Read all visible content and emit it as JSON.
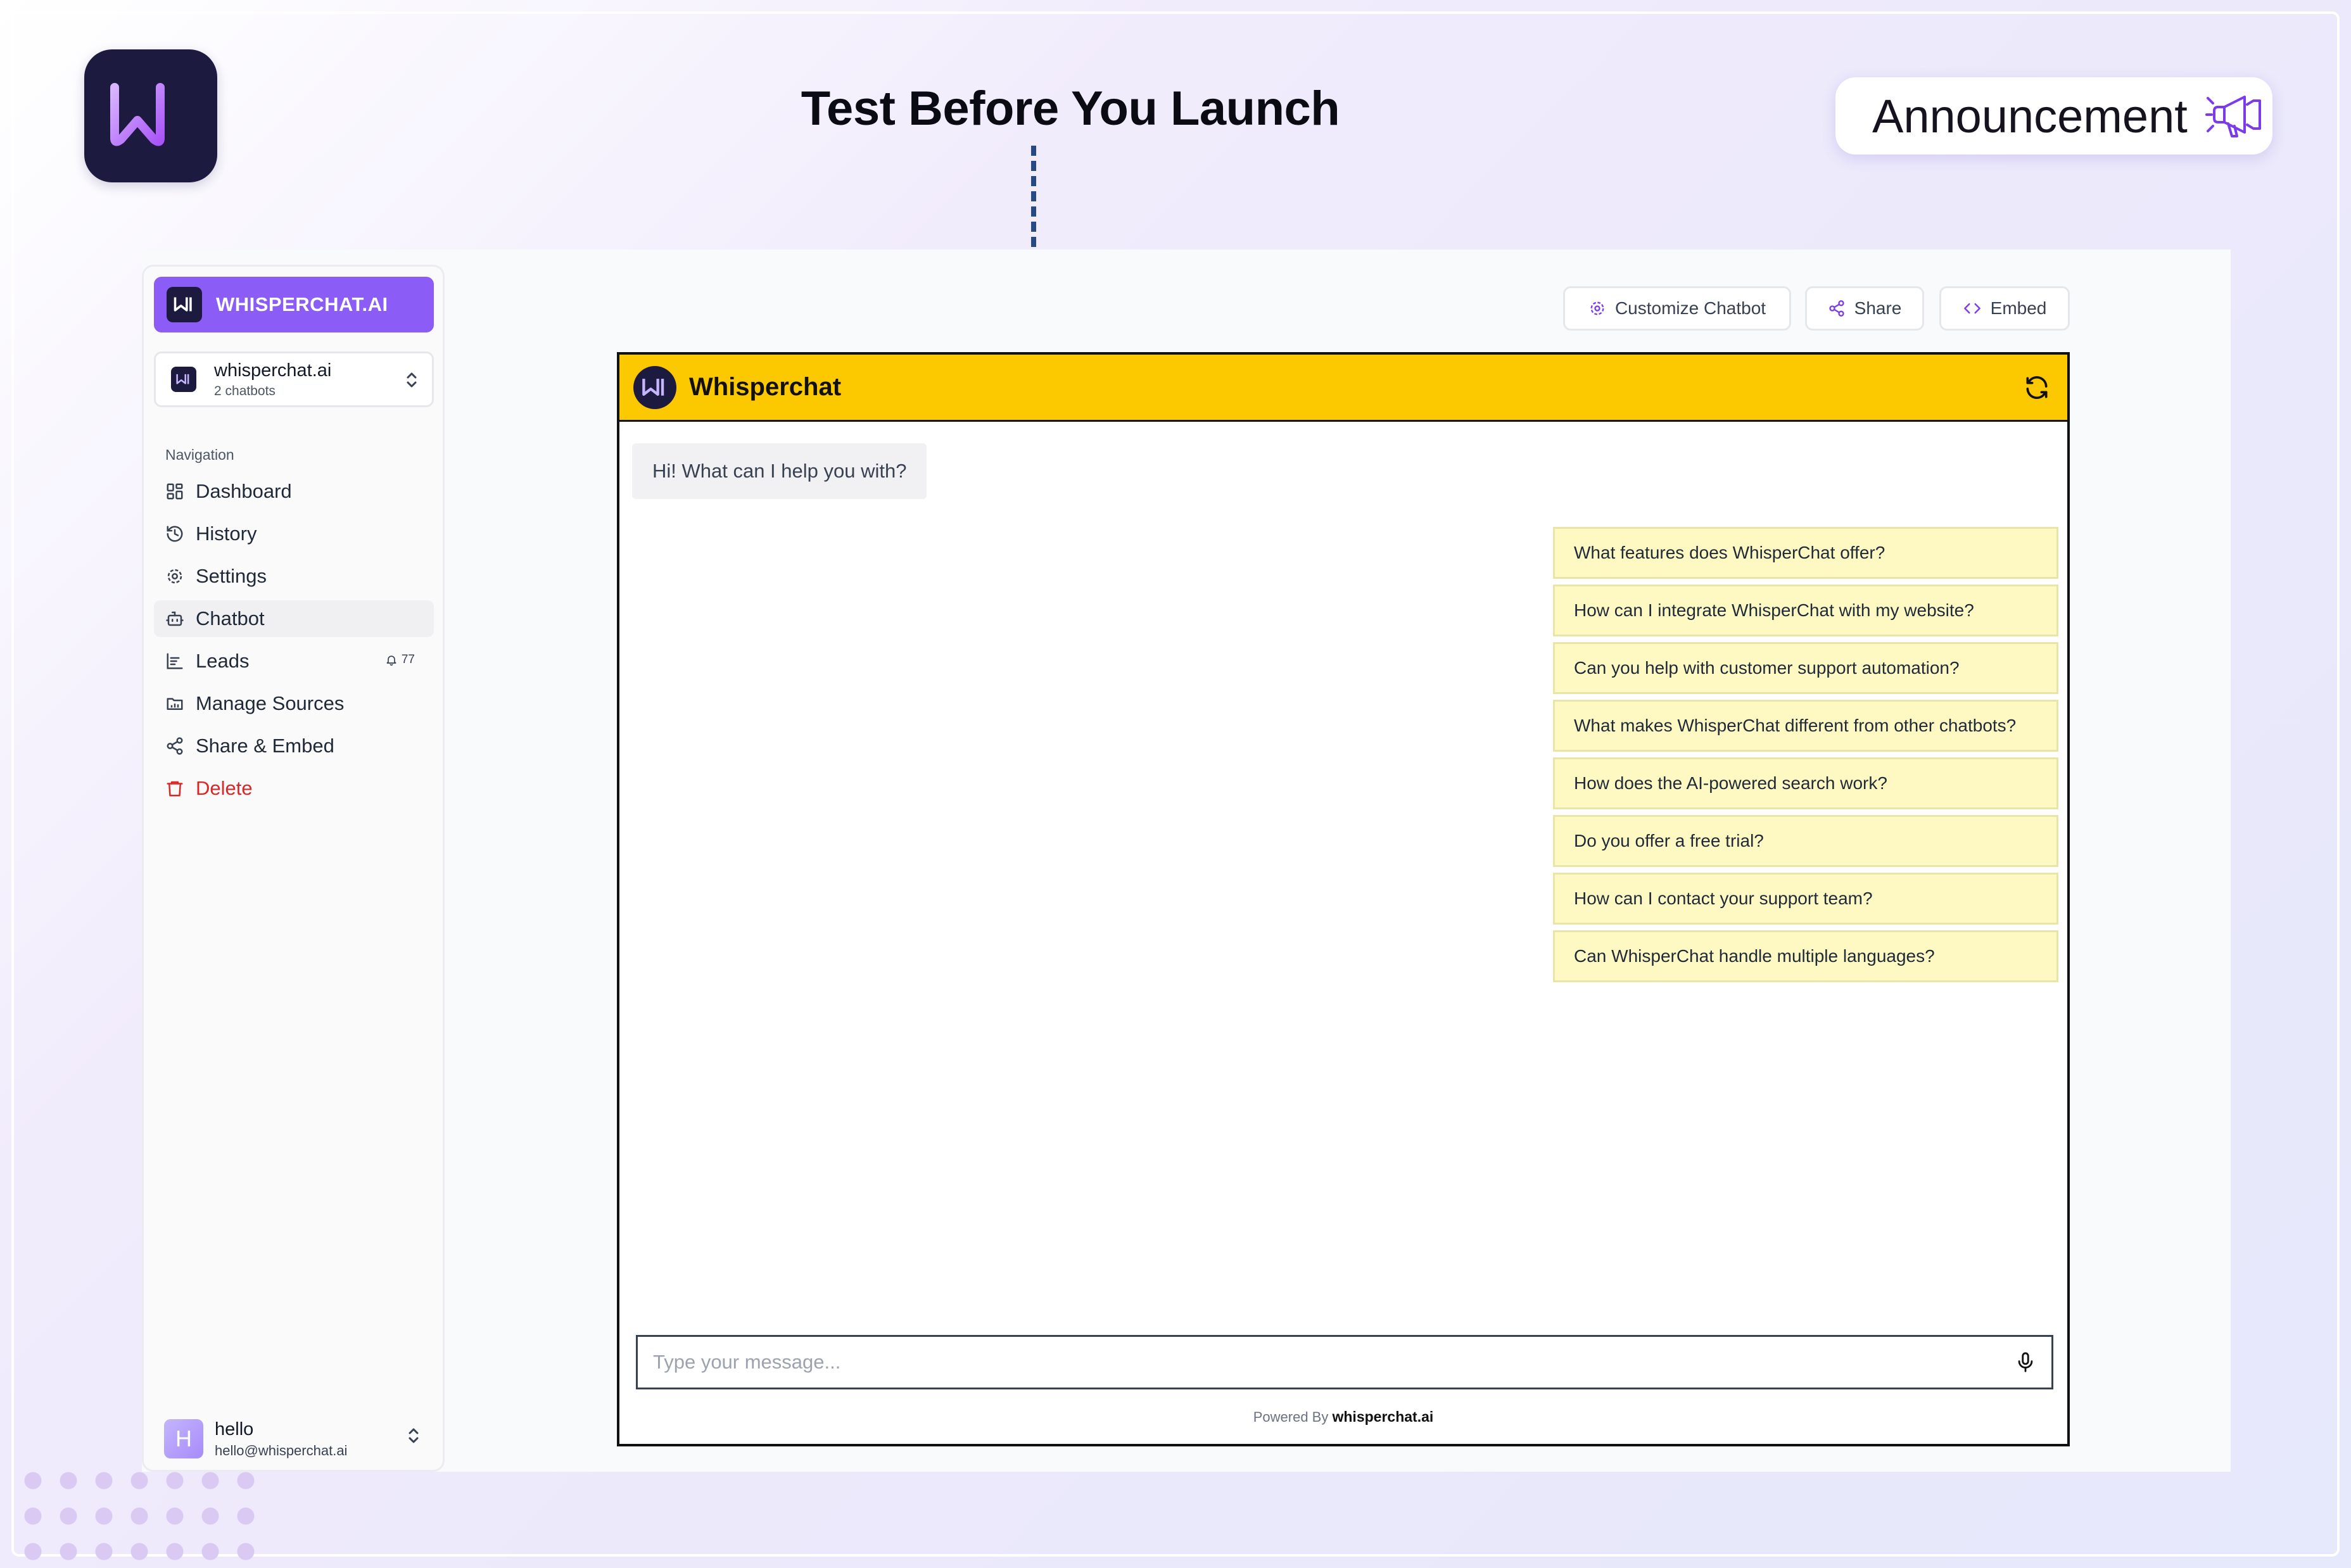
{
  "headline": "Test Before You Launch",
  "announcement": {
    "label": "Announcement",
    "icon": "megaphone-icon"
  },
  "sidebar": {
    "brand": "WHISPERCHAT.AI",
    "workspace": {
      "name": "whisperchat.ai",
      "sub": "2 chatbots"
    },
    "nav_label": "Navigation",
    "items": [
      {
        "label": "Dashboard",
        "icon": "dashboard-icon"
      },
      {
        "label": "History",
        "icon": "history-icon"
      },
      {
        "label": "Settings",
        "icon": "settings-icon"
      },
      {
        "label": "Chatbot",
        "icon": "bot-icon",
        "active": true
      },
      {
        "label": "Leads",
        "icon": "leads-icon",
        "badge": "77"
      },
      {
        "label": "Manage Sources",
        "icon": "folder-icon"
      },
      {
        "label": "Share & Embed",
        "icon": "share-icon"
      },
      {
        "label": "Delete",
        "icon": "trash-icon"
      }
    ],
    "user": {
      "initial": "H",
      "name": "hello",
      "email": "hello@whisperchat.ai"
    }
  },
  "toolbar": {
    "customize": "Customize Chatbot",
    "share": "Share",
    "embed": "Embed"
  },
  "chat": {
    "title": "Whisperchat",
    "greeting": "Hi! What can I help you with?",
    "suggestions": [
      "What features does WhisperChat offer?",
      "How can I integrate WhisperChat with my website?",
      "Can you help with customer support automation?",
      "What makes WhisperChat different from other chatbots?",
      "How does the AI-powered search work?",
      "Do you offer a free trial?",
      "How can I contact your support team?",
      "Can WhisperChat handle multiple languages?"
    ],
    "input_placeholder": "Type your message...",
    "powered_prefix": "Powered By",
    "powered_brand": "whisperchat.ai"
  },
  "colors": {
    "accent": "#8b5cf6",
    "header_yellow": "#fcc800",
    "suggestion_bg": "#fef9c3",
    "logo_bg": "#1d1a3f",
    "danger": "#dc2626"
  }
}
